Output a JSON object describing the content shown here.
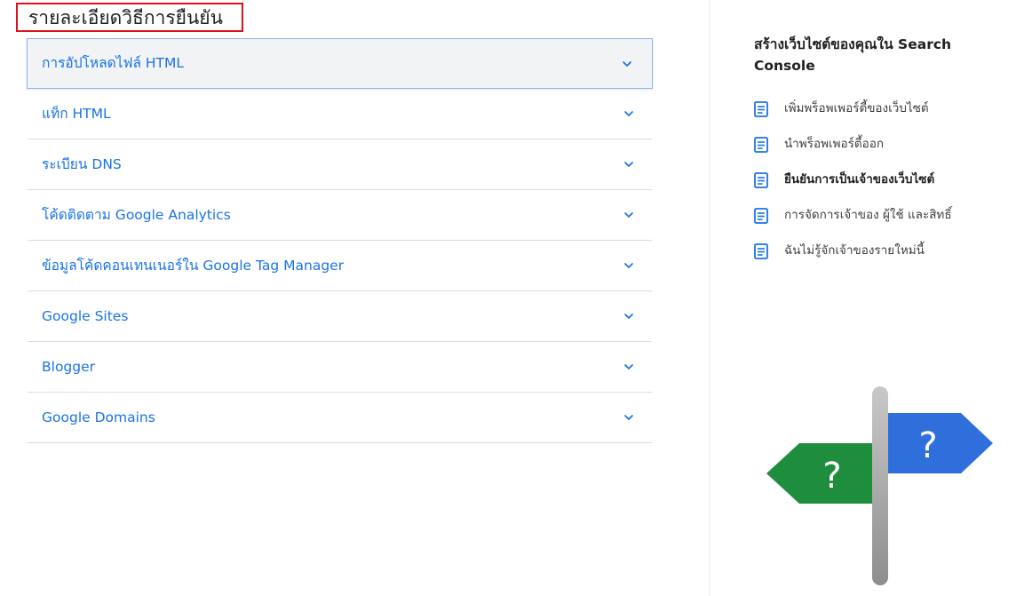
{
  "main": {
    "heading": "รายละเอียดวิธีการยืนยัน",
    "methods": [
      {
        "label": "การอัปโหลดไฟล์ HTML",
        "expanded": false,
        "active": true
      },
      {
        "label": "แท็ก HTML",
        "expanded": false
      },
      {
        "label": "ระเบียน DNS",
        "expanded": false
      },
      {
        "label": "โค้ดติดตาม Google Analytics",
        "expanded": false
      },
      {
        "label": "ข้อมูลโค้ดคอนเทนเนอร์ใน Google Tag Manager",
        "expanded": false
      },
      {
        "label": "Google Sites",
        "expanded": false
      },
      {
        "label": "Blogger",
        "expanded": false
      },
      {
        "label": "Google Domains",
        "expanded": false
      }
    ]
  },
  "sidebar": {
    "title": "สร้างเว็บไซต์ของคุณใน Search Console",
    "items": [
      {
        "label": "เพิ่มพร็อพเพอร์ตี้ของเว็บไซต์",
        "icon": "article-icon"
      },
      {
        "label": "นำพร็อพเพอร์ตี้ออก",
        "icon": "article-icon"
      },
      {
        "label": "ยืนยันการเป็นเจ้าของเว็บไซต์",
        "icon": "article-icon",
        "current": true
      },
      {
        "label": "การจัดการเจ้าของ ผู้ใช้ และสิทธิ์",
        "icon": "article-icon"
      },
      {
        "label": "ฉันไม่รู้จักเจ้าของรายใหม่นี้",
        "icon": "article-icon"
      }
    ],
    "signpost": {
      "left_sign_text": "?",
      "right_sign_text": "?"
    }
  },
  "colors": {
    "link_blue": "#1a73e8",
    "highlight_border": "#e0101a",
    "sign_green": "#1e8e3e",
    "sign_blue": "#1a73e8",
    "pole_gray": "#b0b0b0"
  }
}
